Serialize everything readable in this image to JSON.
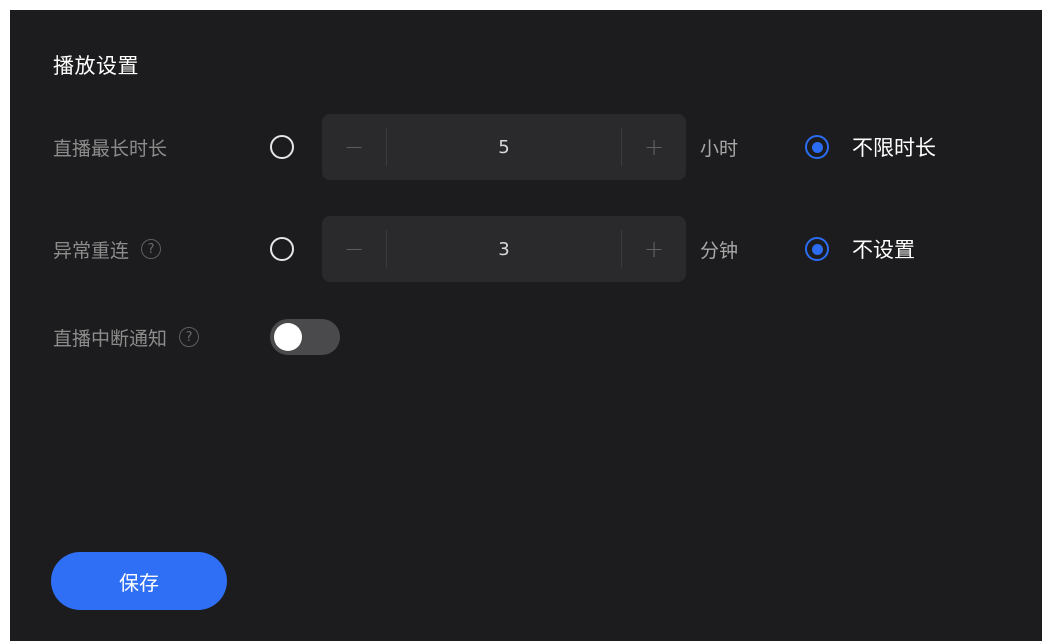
{
  "title": "播放设置",
  "duration": {
    "label": "直播最长时长",
    "minus": "−",
    "plus": "+",
    "value": "5",
    "unit": "小时",
    "custom_selected": false,
    "unlimited_selected": true,
    "unlimited_label": "不限时长"
  },
  "reconnect": {
    "label": "异常重连",
    "help": "?",
    "minus": "−",
    "plus": "+",
    "value": "3",
    "unit": "分钟",
    "custom_selected": false,
    "none_selected": true,
    "none_label": "不设置"
  },
  "interrupt_notice": {
    "label": "直播中断通知",
    "help": "?",
    "enabled": false
  },
  "save_label": "保存",
  "colors": {
    "background": "#1c1c1e",
    "accent": "#2b6cf2",
    "stepper_bg": "#2a2a2c"
  }
}
